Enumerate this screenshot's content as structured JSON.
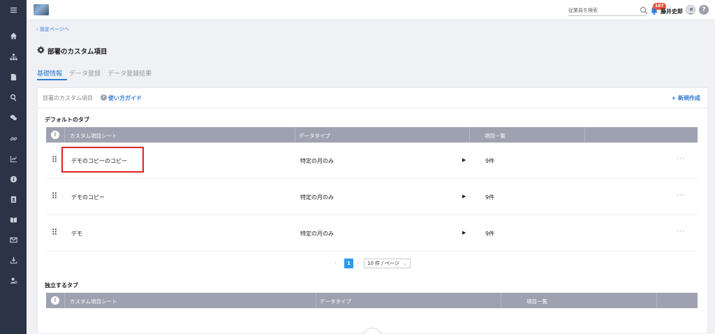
{
  "topbar": {
    "search_placeholder": "従業員を検索",
    "notification_count": "187",
    "user_name": "藤井史郎",
    "help_symbol": "?"
  },
  "breadcrumb": {
    "back_label": "設定ページへ"
  },
  "page": {
    "title": "部署のカスタム項目"
  },
  "tabs": [
    {
      "label": "基礎情報",
      "active": true
    },
    {
      "label": "データ登録",
      "active": false
    },
    {
      "label": "データ登録結果",
      "active": false
    }
  ],
  "card": {
    "title": "部署のカスタム項目",
    "guide_label": "使い方ガイド",
    "new_label": "+ 新規作成"
  },
  "default_section": {
    "label": "デフォルトのタブ",
    "headers": [
      "カスタム項目シート",
      "データタイプ",
      "項目一覧"
    ],
    "rows": [
      {
        "name": "デモのコピーのコピー",
        "data_type": "特定の月のみ",
        "count": "9件"
      },
      {
        "name": "デモのコピー",
        "data_type": "特定の月のみ",
        "count": "9件"
      },
      {
        "name": "デモ",
        "data_type": "特定の月のみ",
        "count": "9件"
      }
    ]
  },
  "pagination": {
    "current_page": "1",
    "page_size_label": "10 件 / ページ"
  },
  "independent_section": {
    "label": "独立するタブ",
    "headers": [
      "カスタム項目シート",
      "データタイプ",
      "項目一覧"
    ]
  },
  "colors": {
    "accent": "#2d7bd8",
    "sidebar": "#2b3346",
    "table_header": "#9ea2b0",
    "highlight": "#e02020",
    "badge": "#e8543d"
  }
}
